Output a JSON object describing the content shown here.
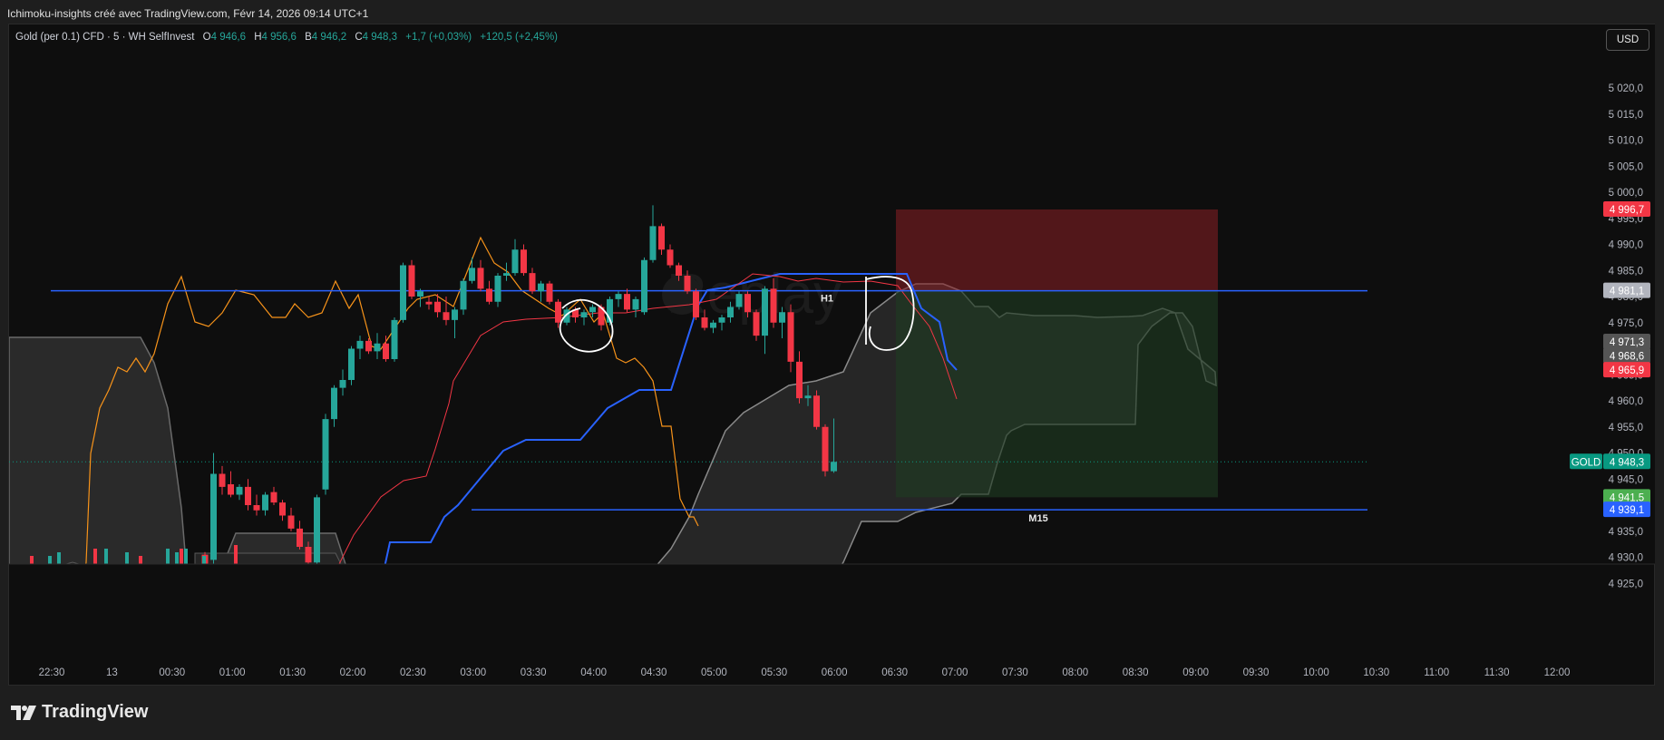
{
  "header": {
    "title": "Ichimoku-insights créé avec TradingView.com, Févr 14, 2026 09:14 UTC+1"
  },
  "legend": {
    "symbol": "Gold (per 0.1) CFD · 5 · WH SelfInvest",
    "o_label": "O",
    "o_value": "4 946,6",
    "h_label": "H",
    "h_value": "4 956,6",
    "b_label": "B",
    "b_value": "4 946,2",
    "c_label": "C",
    "c_value": "4 948,3",
    "change": "+1,7 (+0,03%)",
    "change2": "+120,5 (+2,45%)"
  },
  "toolbar": {
    "currency": "USD"
  },
  "footer": {
    "brand": "TradingView"
  },
  "colors": {
    "up": "#26a69a",
    "down": "#f23645",
    "tenkan": "#f23645",
    "kijun": "#2962ff",
    "chikou": "#f7931a",
    "cloud": "#5a5a5a",
    "stop_zone": "#8b1f24",
    "target_zone": "#1e3a22"
  },
  "chart_data": {
    "type": "candlestick",
    "symbol": "GOLD",
    "timeframe": "5",
    "y_ticks": [
      5020.0,
      5015.0,
      5010.0,
      5005.0,
      5000.0,
      4995.0,
      4990.0,
      4985.0,
      4980.0,
      4975.0,
      4970.0,
      4965.0,
      4960.0,
      4955.0,
      4950.0,
      4945.0,
      4940.0,
      4935.0,
      4930.0,
      4925.0
    ],
    "y_tick_labels": [
      "5 020,0",
      "5 015,0",
      "5 010,0",
      "5 005,0",
      "5 000,0",
      "4 995,0",
      "4 990,0",
      "4 985,0",
      "4 980,0",
      "4 975,0",
      "4 970,0",
      "4 965,0",
      "4 960,0",
      "4 955,0",
      "4 950,0",
      "4 945,0",
      "4 940,0",
      "4 935,0",
      "4 930,0",
      "4 925,0"
    ],
    "x_tick_labels": [
      "22:30",
      "13",
      "00:30",
      "01:00",
      "01:30",
      "02:00",
      "02:30",
      "03:00",
      "03:30",
      "04:00",
      "04:30",
      "05:00",
      "05:30",
      "06:00",
      "06:30",
      "07:00",
      "07:30",
      "08:00",
      "08:30",
      "09:00",
      "09:30",
      "10:00",
      "10:30",
      "11:00",
      "11:30",
      "12:00"
    ],
    "ohlc": [
      [
        4930.5,
        4931.0,
        4925.0,
        4925.5
      ],
      [
        4929.5,
        4950.0,
        4926.0,
        4946.0
      ],
      [
        4946.0,
        4947.5,
        4942.0,
        4943.5
      ],
      [
        4944.0,
        4946.5,
        4941.5,
        4942.0
      ],
      [
        4942.0,
        4944.0,
        4941.0,
        4943.5
      ],
      [
        4943.5,
        4945.0,
        4939.0,
        4940.0
      ],
      [
        4940.0,
        4942.0,
        4938.0,
        4939.0
      ],
      [
        4939.0,
        4942.5,
        4938.0,
        4942.0
      ],
      [
        4942.5,
        4943.5,
        4940.0,
        4940.5
      ],
      [
        4940.5,
        4941.0,
        4937.0,
        4938.0
      ],
      [
        4938.0,
        4939.5,
        4935.0,
        4935.5
      ],
      [
        4935.5,
        4937.0,
        4931.5,
        4932.0
      ],
      [
        4932.0,
        4933.0,
        4928.0,
        4929.0
      ],
      [
        4929.0,
        4942.0,
        4928.5,
        4941.5
      ],
      [
        4943.0,
        4957.5,
        4942.0,
        4956.5
      ],
      [
        4956.5,
        4963.0,
        4955.0,
        4962.5
      ],
      [
        4962.5,
        4966.0,
        4961.0,
        4964.0
      ],
      [
        4964.0,
        4970.5,
        4963.0,
        4970.0
      ],
      [
        4970.0,
        4972.5,
        4968.0,
        4971.5
      ],
      [
        4971.5,
        4972.0,
        4969.0,
        4969.5
      ],
      [
        4969.5,
        4973.0,
        4968.0,
        4971.0
      ],
      [
        4971.0,
        4972.5,
        4967.5,
        4968.0
      ],
      [
        4968.0,
        4976.0,
        4967.5,
        4975.5
      ],
      [
        4975.5,
        4986.5,
        4975.0,
        4986.0
      ],
      [
        4986.0,
        4987.0,
        4979.5,
        4980.0
      ],
      [
        4980.0,
        4981.5,
        4978.0,
        4981.0
      ],
      [
        4979.0,
        4980.0,
        4977.5,
        4978.5
      ],
      [
        4979.0,
        4980.5,
        4976.0,
        4977.0
      ],
      [
        4977.0,
        4980.0,
        4974.5,
        4975.5
      ],
      [
        4975.5,
        4978.0,
        4972.0,
        4977.5
      ],
      [
        4977.5,
        4983.5,
        4976.5,
        4983.0
      ],
      [
        4983.0,
        4987.5,
        4982.5,
        4985.5
      ],
      [
        4985.5,
        4987.0,
        4981.0,
        4981.5
      ],
      [
        4981.5,
        4983.0,
        4978.5,
        4979.0
      ],
      [
        4979.0,
        4984.5,
        4978.0,
        4984.0
      ],
      [
        4984.0,
        4986.5,
        4983.0,
        4984.5
      ],
      [
        4984.5,
        4991.0,
        4984.0,
        4989.0
      ],
      [
        4989.0,
        4990.0,
        4984.0,
        4984.5
      ],
      [
        4984.5,
        4985.5,
        4980.5,
        4981.0
      ],
      [
        4981.0,
        4983.0,
        4979.0,
        4982.5
      ],
      [
        4982.5,
        4983.0,
        4978.5,
        4979.0
      ],
      [
        4979.0,
        4979.5,
        4974.0,
        4975.0
      ],
      [
        4975.0,
        4978.0,
        4974.5,
        4977.5
      ],
      [
        4977.5,
        4978.0,
        4975.0,
        4976.0
      ],
      [
        4976.0,
        4977.5,
        4974.5,
        4977.0
      ],
      [
        4977.0,
        4978.5,
        4976.0,
        4978.0
      ],
      [
        4978.0,
        4978.5,
        4973.5,
        4974.5
      ],
      [
        4975.0,
        4980.0,
        4974.5,
        4979.5
      ],
      [
        4979.5,
        4981.0,
        4978.0,
        4980.5
      ],
      [
        4980.5,
        4981.5,
        4977.0,
        4977.5
      ],
      [
        4977.5,
        4980.0,
        4976.0,
        4979.5
      ],
      [
        4977.0,
        4987.5,
        4976.5,
        4987.0
      ],
      [
        4987.0,
        4997.5,
        4986.5,
        4993.5
      ],
      [
        4993.5,
        4994.0,
        4988.0,
        4989.0
      ],
      [
        4989.0,
        4990.0,
        4985.5,
        4986.0
      ],
      [
        4986.0,
        4986.5,
        4983.0,
        4984.0
      ],
      [
        4984.0,
        4985.0,
        4980.5,
        4981.0
      ],
      [
        4981.0,
        4981.5,
        4975.5,
        4976.0
      ],
      [
        4976.0,
        4977.5,
        4973.5,
        4974.0
      ],
      [
        4974.0,
        4975.5,
        4973.0,
        4975.0
      ],
      [
        4975.0,
        4976.5,
        4973.5,
        4976.0
      ],
      [
        4976.0,
        4979.0,
        4975.0,
        4978.0
      ],
      [
        4978.0,
        4981.0,
        4977.5,
        4980.5
      ],
      [
        4980.5,
        4981.0,
        4976.0,
        4977.0
      ],
      [
        4977.0,
        4977.5,
        4971.5,
        4972.5
      ],
      [
        4972.5,
        4982.0,
        4969.0,
        4981.5
      ],
      [
        4981.5,
        4983.5,
        4974.0,
        4975.0
      ],
      [
        4975.0,
        4978.0,
        4972.0,
        4977.0
      ],
      [
        4977.0,
        4978.5,
        4965.5,
        4967.5
      ],
      [
        4967.5,
        4969.5,
        4959.5,
        4960.5
      ],
      [
        4960.5,
        4963.0,
        4959.0,
        4961.0
      ],
      [
        4961.0,
        4962.0,
        4954.5,
        4955.0
      ],
      [
        4955.0,
        4955.5,
        4945.5,
        4946.5
      ],
      [
        4946.5,
        4956.6,
        4946.2,
        4948.3
      ]
    ],
    "price_labels": [
      {
        "value": 4996.7,
        "label": "4 996,7",
        "color": "#f23645"
      },
      {
        "value": 4981.1,
        "label": "4 981,1",
        "color": "#b2b5be"
      },
      {
        "value": 4971.3,
        "label": "4 971,3",
        "color": "#555555"
      },
      {
        "value": 4968.6,
        "label": "4 968,6",
        "color": "#555555"
      },
      {
        "value": 4965.9,
        "label": "4 965,9",
        "color": "#f23645"
      },
      {
        "value": 4948.3,
        "label": "4 948,3",
        "color": "#089981",
        "tag": "GOLD"
      },
      {
        "value": 4941.5,
        "label": "4 941,5",
        "color": "#4caf50"
      },
      {
        "value": 4939.1,
        "label": "4 939,1",
        "color": "#2962ff"
      }
    ],
    "horizontal_lines": [
      {
        "value": 4981.1,
        "label": "H1"
      },
      {
        "value": 4939.1,
        "label": "M15"
      }
    ],
    "position": {
      "entry": 4981.1,
      "stop": 4996.7,
      "target": 4941.5
    },
    "watermark": "Replay"
  }
}
